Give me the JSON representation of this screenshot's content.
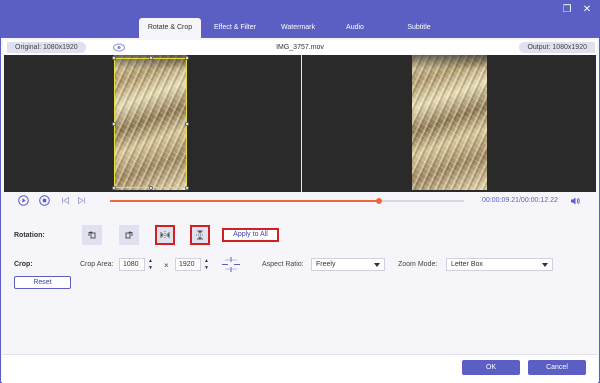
{
  "window": {
    "restore_glyph": "❐",
    "close_glyph": "✕"
  },
  "tabs": [
    {
      "label": "Rotate & Crop",
      "active": true
    },
    {
      "label": "Effect & Filter",
      "active": false
    },
    {
      "label": "Watermark",
      "active": false
    },
    {
      "label": "Audio",
      "active": false
    },
    {
      "label": "Subtitle",
      "active": false
    }
  ],
  "info": {
    "original": "Original: 1080x1920",
    "filename": "IMG_3757.mov",
    "output": "Output: 1080x1920"
  },
  "playback": {
    "progress": 0.76,
    "time": "00:00:09.21/00:00:12.22"
  },
  "rotation": {
    "label": "Rotation:",
    "apply_all": "Apply to All"
  },
  "crop": {
    "label": "Crop:",
    "area_label": "Crop Area:",
    "width": "1080",
    "times": "×",
    "height": "1920",
    "aspect_label": "Aspect Ratio:",
    "aspect_value": "Freely",
    "zoom_label": "Zoom Mode:",
    "zoom_value": "Letter Box",
    "reset": "Reset"
  },
  "footer": {
    "ok": "OK",
    "cancel": "Cancel"
  },
  "colors": {
    "accent": "#5b5ec2",
    "progress": "#ee6a3c",
    "highlight": "#d02020",
    "crop_border": "#e6dc3c"
  }
}
